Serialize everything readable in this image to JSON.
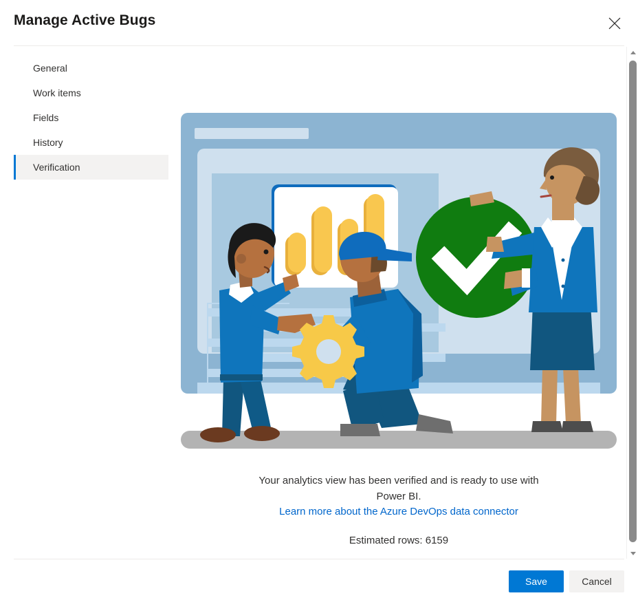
{
  "dialog": {
    "title": "Manage Active Bugs",
    "close_icon": "close-icon"
  },
  "sidebar": {
    "items": [
      {
        "label": "General",
        "selected": false
      },
      {
        "label": "Work items",
        "selected": false
      },
      {
        "label": "Fields",
        "selected": false
      },
      {
        "label": "History",
        "selected": false
      },
      {
        "label": "Verification",
        "selected": true
      }
    ]
  },
  "content": {
    "illustration": {
      "name": "verification-success-illustration",
      "description": "Three people around a dashboard with a large green checkmark",
      "colors": {
        "panel_outer": "#8cb4d2",
        "panel_mid": "#cfe0ee",
        "panel_inner": "#a8c9e0",
        "bar_light": "#bcd8ee",
        "card_white": "#ffffff",
        "card_border": "#0f6cbd",
        "chart_bar": "#f9c74f",
        "chart_bar_shadow": "#e8b03c",
        "check_green": "#107c10",
        "check_white": "#ffffff",
        "shirt_blue": "#0f75bc",
        "pants_blue": "#11567f",
        "ground_gray": "#b3b3b3",
        "gear_yellow": "#f7c948"
      },
      "chart_bars": [
        4,
        8,
        6,
        10
      ]
    },
    "verified_message": "Your analytics view has been verified and is ready to use with Power BI.",
    "learn_more_label": "Learn more about the Azure DevOps data connector",
    "estimated_rows_label": "Estimated rows: 6159"
  },
  "scrollbar": {
    "up_icon": "chevron-up-icon",
    "down_icon": "chevron-down-icon"
  },
  "footer": {
    "save_label": "Save",
    "cancel_label": "Cancel"
  },
  "theme": {
    "accent": "#0078d4",
    "link": "#0066cc",
    "selected_row_bg": "#f3f2f1",
    "text": "#323130"
  }
}
